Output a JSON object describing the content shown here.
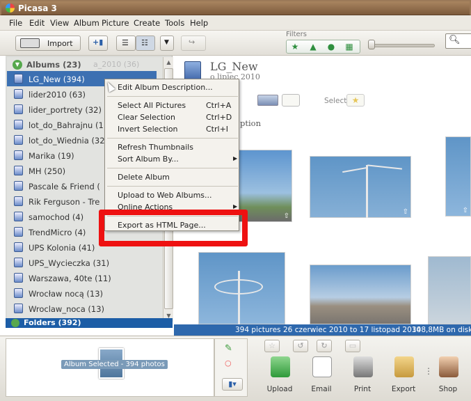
{
  "window": {
    "title": "Picasa 3"
  },
  "menubar": [
    "File",
    "Edit",
    "View",
    "Album",
    "Picture",
    "Create",
    "Tools",
    "Help"
  ],
  "toolbar": {
    "import_label": "Import",
    "filters_label": "Filters"
  },
  "albums": {
    "header": "Albums (23)",
    "ghost_text": "a_2010 (36)",
    "items": [
      {
        "name": "LG_New (394)",
        "selected": true
      },
      {
        "name": "lider2010 (63)"
      },
      {
        "name": "lider_portrety (32)"
      },
      {
        "name": "lot_do_Bahrajnu (1"
      },
      {
        "name": "lot_do_Wiednia (32"
      },
      {
        "name": "Marika (19)"
      },
      {
        "name": "MH (250)"
      },
      {
        "name": "Pascale & Friend ("
      },
      {
        "name": "Rik Ferguson - Tre"
      },
      {
        "name": "samochod (4)"
      },
      {
        "name": "TrendMicro (4)"
      },
      {
        "name": "UPS Kolonia (41)"
      },
      {
        "name": "UPS_Wycieczka (31)"
      },
      {
        "name": "Warszawa, 40te (11)"
      },
      {
        "name": "Wrocław nocą (13)"
      },
      {
        "name": "Wroclaw_noca (13)"
      }
    ],
    "folders_header": "Folders (392)"
  },
  "main": {
    "album_title": "LG_New",
    "album_date": "o lipiec 2010",
    "select_label": "Select",
    "description_fragment": "ption"
  },
  "context_menu": {
    "items": [
      {
        "label": "Edit Album Description...",
        "shortcut": ""
      },
      {
        "label": "Select All Pictures",
        "shortcut": "Ctrl+A"
      },
      {
        "label": "Clear Selection",
        "shortcut": "Ctrl+D"
      },
      {
        "label": "Invert Selection",
        "shortcut": "Ctrl+I"
      },
      {
        "label": "Refresh Thumbnails",
        "shortcut": ""
      },
      {
        "label": "Sort Album By...",
        "shortcut": ""
      },
      {
        "label": "Delete Album",
        "shortcut": ""
      },
      {
        "label": "Upload to Web Albums...",
        "shortcut": ""
      },
      {
        "label": "Online Actions",
        "shortcut": ""
      },
      {
        "label": "Export as HTML Page...",
        "shortcut": ""
      }
    ]
  },
  "statusbar": {
    "count": "394 pictures",
    "range": "26 czerwiec 2010 to 17 listopad 2010",
    "size": "348,8MB on disk"
  },
  "tray": {
    "album_selected": "Album Selected - 394 photos",
    "actions": [
      "Upload",
      "Email",
      "Print",
      "Export",
      "Shop"
    ]
  },
  "colors": {
    "selection": "#3c70b2",
    "status": "#2e68ad",
    "highlight": "#ee1111"
  }
}
